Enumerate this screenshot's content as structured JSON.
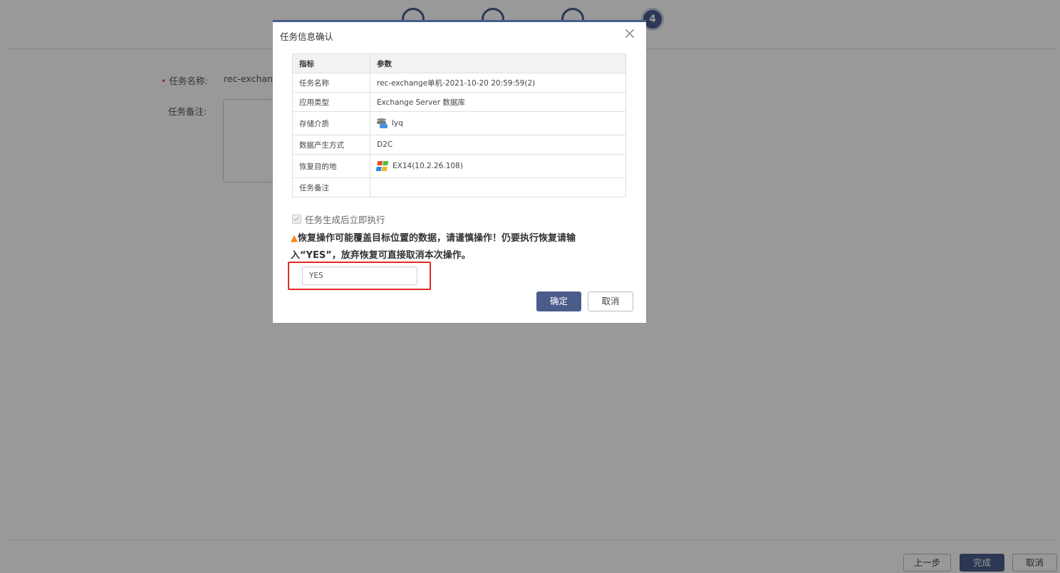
{
  "steps": [
    "",
    "",
    "",
    "4"
  ],
  "form": {
    "task_name_label": "任务名称:",
    "task_name_value": "rec-exchang",
    "task_note_label": "任务备注:"
  },
  "footer": {
    "prev_label": "上一步",
    "finish_label": "完成",
    "cancel_label": "取消"
  },
  "modal": {
    "title": "任务信息确认",
    "close_icon": "×",
    "table": {
      "headers": [
        "指标",
        "参数"
      ],
      "rows": [
        {
          "key": "任务名称",
          "value": "rec-exchange单机-2021-10-20 20:59:59(2)"
        },
        {
          "key": "应用类型",
          "value": "Exchange Server 数据库"
        },
        {
          "key": "存储介质",
          "value": "lyq",
          "icon": "database-user-icon"
        },
        {
          "key": "数据产生方式",
          "value": "D2C"
        },
        {
          "key": "恢复目的地",
          "value": "EX14(10.2.26.108)",
          "icon": "windows-icon"
        },
        {
          "key": "任务备注",
          "value": ""
        }
      ]
    },
    "checkbox_label": "任务生成后立即执行",
    "warning_icon": "▲",
    "warning_text": "恢复操作可能覆盖目标位置的数据，请谨慎操作！仍要执行恢复请输入“YES”，放弃恢复可直接取消本次操作。",
    "confirm_input_value": "YES",
    "confirm_label": "确定",
    "cancel_label": "取消"
  },
  "colors": {
    "primary": "#4a5c8a",
    "highlight_border": "#e22828",
    "warning": "#f08c1a",
    "overlay": "rgba(0,0,0,0.4)"
  }
}
